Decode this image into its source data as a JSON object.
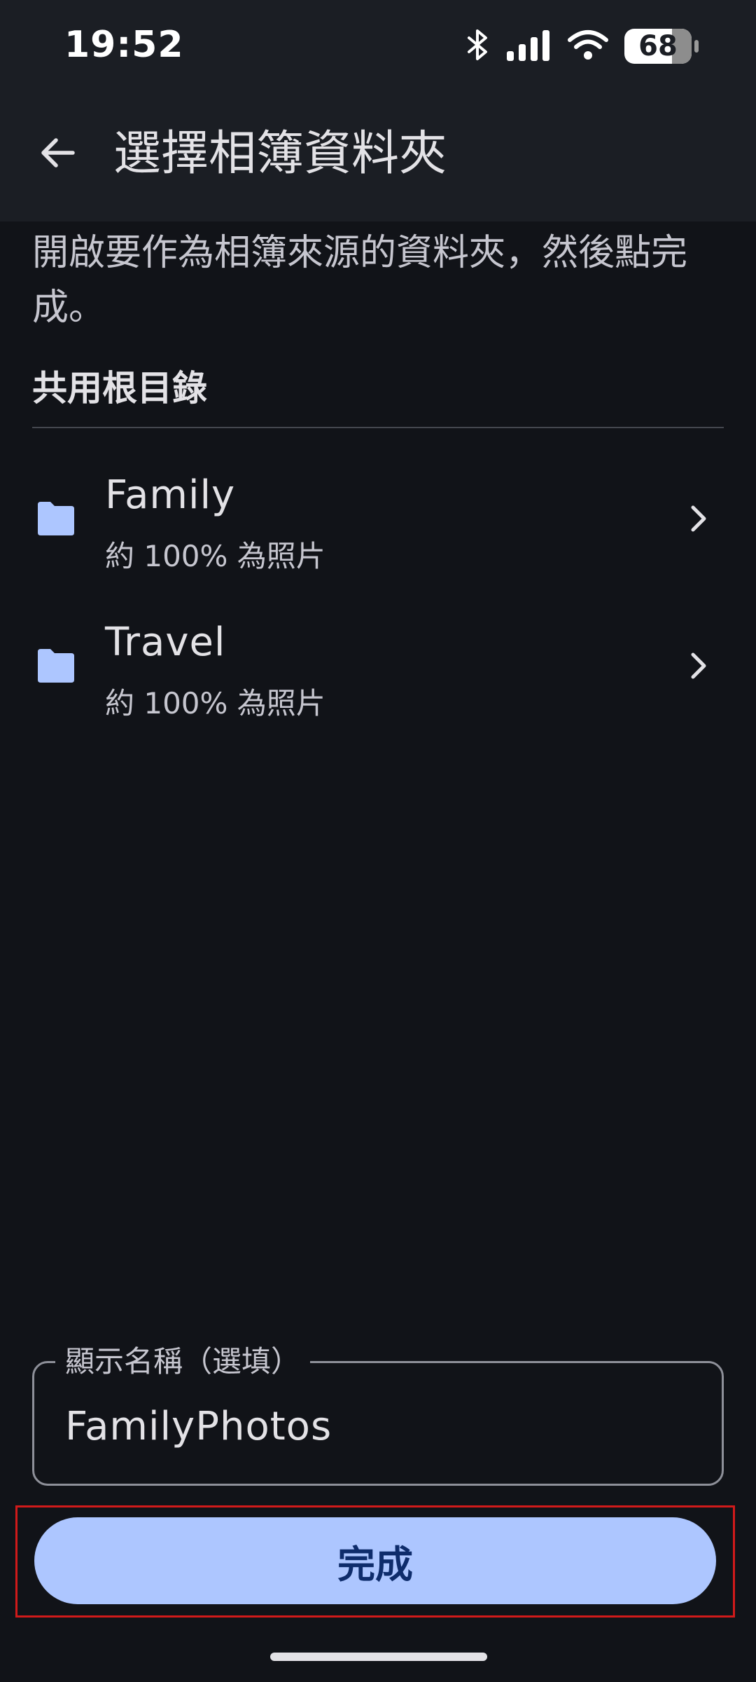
{
  "status_bar": {
    "time": "19:52",
    "battery": "68",
    "icons": [
      "bluetooth-icon",
      "signal-icon",
      "wifi-icon",
      "battery-icon"
    ]
  },
  "app_bar": {
    "title": "選擇相簿資料夾",
    "back_icon": "arrow-back-icon"
  },
  "instructions": "開啟要作為相簿來源的資料夾，然後點完成。",
  "section": {
    "title": "共用根目錄"
  },
  "folders": [
    {
      "name": "Family",
      "subtitle": "約 100% 為照片",
      "icon": "folder-icon"
    },
    {
      "name": "Travel",
      "subtitle": "約 100% 為照片",
      "icon": "folder-icon"
    }
  ],
  "display_name_field": {
    "label": "顯示名稱（選填）",
    "value": "FamilyPhotos"
  },
  "done_button": {
    "label": "完成"
  },
  "colors": {
    "background": "#111318",
    "app_bar": "#1b1e24",
    "accent": "#adc6ff",
    "folder_icon": "#adc6ff",
    "button_text": "#0e2c6b"
  }
}
